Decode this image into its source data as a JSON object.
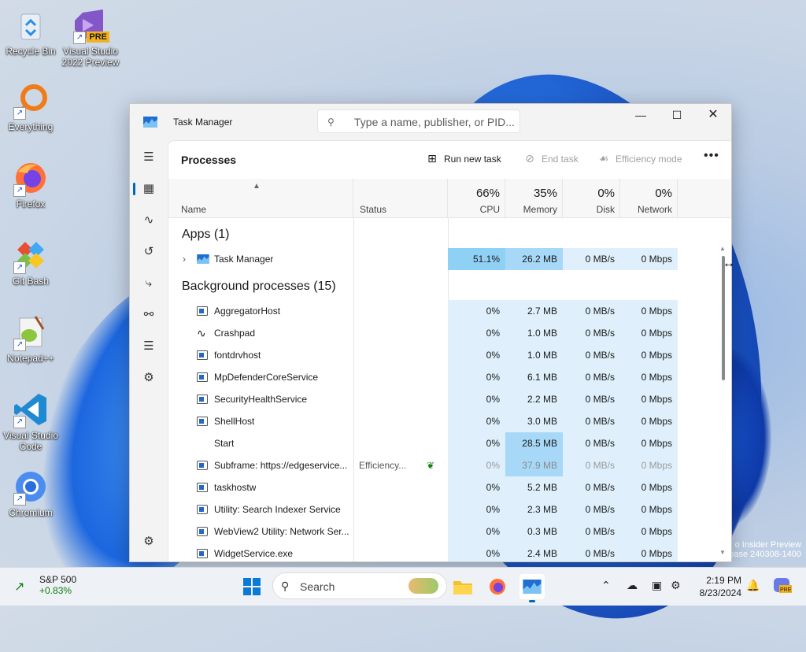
{
  "desktop": {
    "icons": [
      {
        "label": "Recycle Bin",
        "icon": "recycle-bin-icon"
      },
      {
        "label": "Visual Studio 2022 Preview",
        "icon": "visual-studio-preview-icon",
        "badge": "PRE"
      },
      {
        "label": "Everything",
        "icon": "everything-search-icon"
      },
      {
        "label": "Firefox",
        "icon": "firefox-icon"
      },
      {
        "label": "Git Bash",
        "icon": "git-bash-icon"
      },
      {
        "label": "Notepad++",
        "icon": "notepad-plus-plus-icon"
      },
      {
        "label": "Visual Studio Code",
        "icon": "vscode-icon"
      },
      {
        "label": "Chromium",
        "icon": "chromium-icon"
      }
    ],
    "watermark_line1": "o Insider Preview",
    "watermark_line2": "ease 240308-1400"
  },
  "window": {
    "title": "Task Manager",
    "search_placeholder": "Type a name, publisher, or PID...",
    "page_title": "Processes",
    "toolbar": {
      "run_new_task": "Run new task",
      "end_task": "End task",
      "efficiency_mode": "Efficiency mode",
      "more": "•••"
    },
    "columns": {
      "name": "Name",
      "status": "Status",
      "cpu_pct": "66%",
      "cpu": "CPU",
      "memory_pct": "35%",
      "memory": "Memory",
      "disk_pct": "0%",
      "disk": "Disk",
      "network_pct": "0%",
      "network": "Network"
    },
    "groups": {
      "apps": "Apps (1)",
      "background": "Background processes (15)"
    },
    "apps": [
      {
        "name": "Task Manager",
        "status": "",
        "cpu": "51.1%",
        "memory": "26.2 MB",
        "disk": "0 MB/s",
        "network": "0 Mbps"
      }
    ],
    "background": [
      {
        "name": "AggregatorHost",
        "status": "",
        "cpu": "0%",
        "memory": "2.7 MB",
        "disk": "0 MB/s",
        "network": "0 Mbps",
        "icon": "app-window-icon"
      },
      {
        "name": "Crashpad",
        "status": "",
        "cpu": "0%",
        "memory": "1.0 MB",
        "disk": "0 MB/s",
        "network": "0 Mbps",
        "icon": "pulse-icon"
      },
      {
        "name": "fontdrvhost",
        "status": "",
        "cpu": "0%",
        "memory": "1.0 MB",
        "disk": "0 MB/s",
        "network": "0 Mbps",
        "icon": "app-window-icon"
      },
      {
        "name": "MpDefenderCoreService",
        "status": "",
        "cpu": "0%",
        "memory": "6.1 MB",
        "disk": "0 MB/s",
        "network": "0 Mbps",
        "icon": "app-window-icon"
      },
      {
        "name": "SecurityHealthService",
        "status": "",
        "cpu": "0%",
        "memory": "2.2 MB",
        "disk": "0 MB/s",
        "network": "0 Mbps",
        "icon": "app-window-icon"
      },
      {
        "name": "ShellHost",
        "status": "",
        "cpu": "0%",
        "memory": "3.0 MB",
        "disk": "0 MB/s",
        "network": "0 Mbps",
        "icon": "app-window-icon"
      },
      {
        "name": "Start",
        "status": "",
        "cpu": "0%",
        "memory": "28.5 MB",
        "disk": "0 MB/s",
        "network": "0 Mbps",
        "icon": "none"
      },
      {
        "name": "Subframe: https://edgeservice...",
        "status": "Efficiency...",
        "cpu": "0%",
        "memory": "37.9 MB",
        "disk": "0 MB/s",
        "network": "0 Mbps",
        "icon": "frame-icon"
      },
      {
        "name": "taskhostw",
        "status": "",
        "cpu": "0%",
        "memory": "5.2 MB",
        "disk": "0 MB/s",
        "network": "0 Mbps",
        "icon": "app-window-icon"
      },
      {
        "name": "Utility: Search Indexer Service",
        "status": "",
        "cpu": "0%",
        "memory": "2.3 MB",
        "disk": "0 MB/s",
        "network": "0 Mbps",
        "icon": "briefcase-icon"
      },
      {
        "name": "WebView2 Utility: Network Ser...",
        "status": "",
        "cpu": "0%",
        "memory": "0.3 MB",
        "disk": "0 MB/s",
        "network": "0 Mbps",
        "icon": "briefcase-icon"
      },
      {
        "name": "WidgetService.exe",
        "status": "",
        "cpu": "0%",
        "memory": "2.4 MB",
        "disk": "0 MB/s",
        "network": "0 Mbps",
        "icon": "app-window-icon"
      }
    ]
  },
  "taskbar": {
    "stock_name": "S&P 500",
    "stock_change": "+0.83%",
    "search_label": "Search",
    "time": "2:19 PM",
    "date": "8/23/2024"
  },
  "colors": {
    "accent": "#0067c0",
    "cpu_highlight": "#8fd0f5",
    "memory_highlight": "#a7d8f7",
    "light_cell": "#dff0fc"
  }
}
